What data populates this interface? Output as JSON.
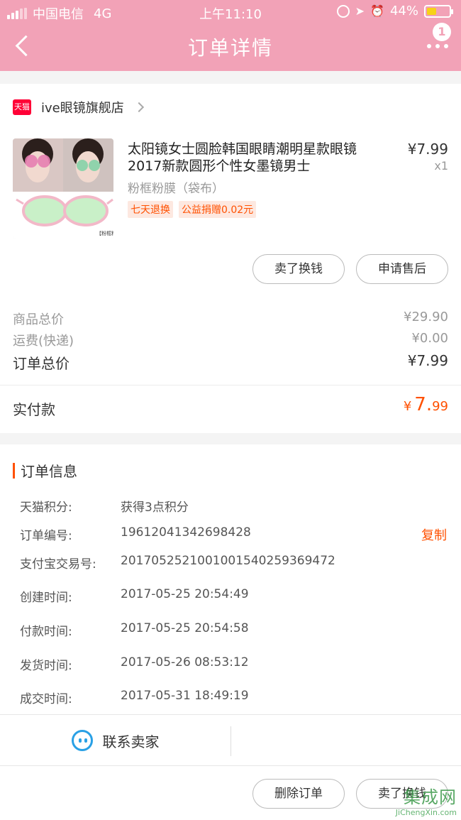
{
  "status_bar": {
    "carrier": "中国电信",
    "network": "4G",
    "time": "上午11:10",
    "battery": "44%",
    "battery_level": 0.44
  },
  "nav": {
    "title": "订单详情",
    "badge_count": "1"
  },
  "store": {
    "logo_text": "天猫",
    "name": "ive眼镜旗舰店"
  },
  "product": {
    "title": "太阳镜女士圆脸韩国眼睛潮明星款眼镜2017新款圆形个性女墨镜男士",
    "spec": "粉框粉膜（袋布）",
    "price": "¥7.99",
    "qty": "x1",
    "tags": [
      "七天退换",
      "公益捐赠0.02元"
    ],
    "image_caption": "【粉框粉膜】"
  },
  "actions": {
    "sell": "卖了换钱",
    "after_sale": "申请售后",
    "delete": "删除订单",
    "sell_bottom": "卖了换钱"
  },
  "summary": {
    "goods_label": "商品总价",
    "goods_value": "¥29.90",
    "ship_label": "运费(快递)",
    "ship_value": "¥0.00",
    "total_label": "订单总价",
    "total_value": "¥7.99",
    "paid_label": "实付款",
    "paid_symbol": "¥",
    "paid_int": "7.",
    "paid_dec": "99"
  },
  "order_info": {
    "title": "订单信息",
    "copy_label": "复制",
    "rows": [
      {
        "key": "天猫积分:",
        "value": "获得3点积分"
      },
      {
        "key": "订单编号:",
        "value": "19612041342698428"
      },
      {
        "key": "支付宝交易号:",
        "value": "2017052521001001540259369472"
      },
      {
        "key": "创建时间:",
        "value": "2017-05-25 20:54:49"
      },
      {
        "key": "付款时间:",
        "value": "2017-05-25 20:54:58"
      },
      {
        "key": "发货时间:",
        "value": "2017-05-26 08:53:12"
      },
      {
        "key": "成交时间:",
        "value": "2017-05-31 18:49:19"
      }
    ]
  },
  "contact": {
    "label": "联系卖家"
  },
  "watermark": {
    "main": "集成网",
    "sub": "JiChengXin.com"
  },
  "colors": {
    "header": "#f2a2b7",
    "accent": "#ff5000",
    "chat": "#29a0e5"
  }
}
